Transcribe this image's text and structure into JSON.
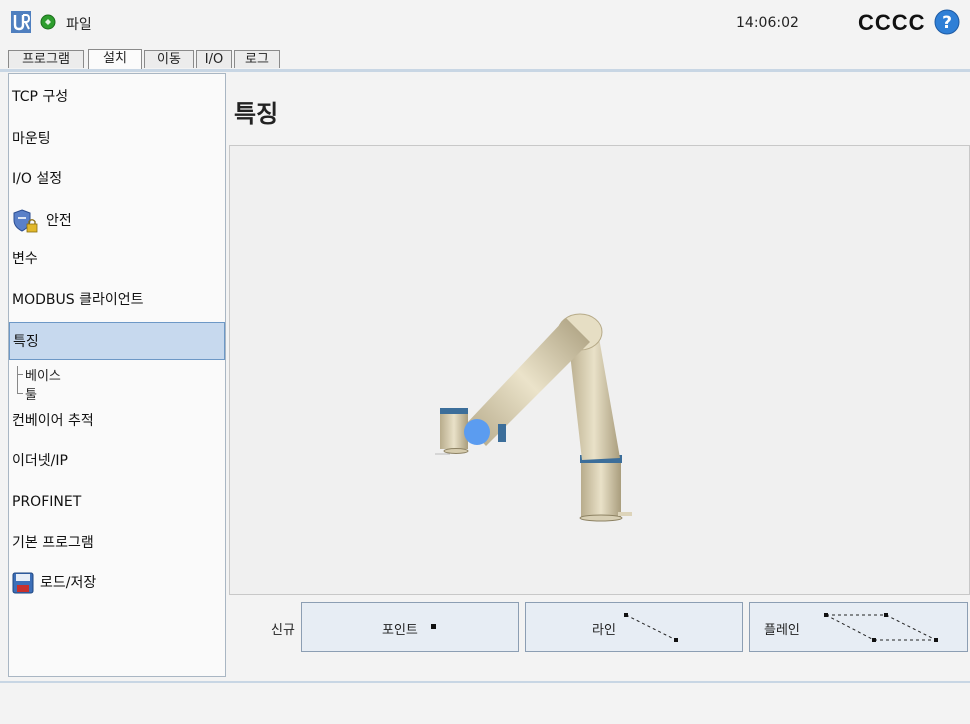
{
  "header": {
    "file_menu": "파일",
    "clock": "14:06:02",
    "robot_name": "CCCC"
  },
  "tabs": [
    {
      "label": "프로그램",
      "active": false
    },
    {
      "label": "설치",
      "active": true
    },
    {
      "label": "이동",
      "active": false
    },
    {
      "label": "I/O",
      "active": false
    },
    {
      "label": "로그",
      "active": false
    }
  ],
  "sidebar": {
    "items": [
      {
        "label": "TCP 구성"
      },
      {
        "label": "마운팅"
      },
      {
        "label": "I/O 설정"
      },
      {
        "label": "안전",
        "icon": "shield-lock-icon"
      },
      {
        "label": "변수"
      },
      {
        "label": "MODBUS 클라이언트"
      },
      {
        "label": "특징",
        "selected": true
      },
      {
        "label": "컨베이어 추적"
      },
      {
        "label": "이더넷/IP"
      },
      {
        "label": "PROFINET"
      },
      {
        "label": "기본 프로그램"
      },
      {
        "label": "로드/저장",
        "icon": "save-disk-icon"
      }
    ],
    "sub_items": [
      {
        "label": "베이스"
      },
      {
        "label": "툴"
      }
    ]
  },
  "main": {
    "title": "특징",
    "new_label": "신규",
    "buttons": [
      {
        "label": "포인트",
        "icon": "point-icon"
      },
      {
        "label": "라인",
        "icon": "line-icon"
      },
      {
        "label": "플레인",
        "icon": "plane-icon"
      }
    ]
  },
  "colors": {
    "accent": "#c7d9ee",
    "status_ok": "#2e9e2e",
    "help": "#2f7fd6"
  }
}
